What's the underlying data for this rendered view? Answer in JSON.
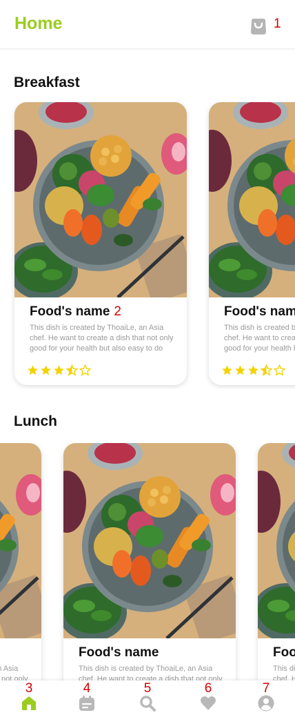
{
  "header": {
    "title": "Home",
    "cart_count": "1"
  },
  "sections": {
    "breakfast": {
      "title": "Breakfast",
      "cards": [
        {
          "name": "Food's name",
          "name_badge": "2",
          "description": "This dish is created by ThoaiLe, an Asia chef. He want to create a dish that not only good for your health but also easy to do",
          "rating": 3.5
        },
        {
          "name": "Food's name",
          "name_badge": "",
          "description": "This dish is created by ThoaiLe, an Asia chef. He want to create a dish that not only good for your health but also easy to do",
          "rating": 3.5
        }
      ]
    },
    "lunch": {
      "title": "Lunch",
      "cards": [
        {
          "name": "",
          "description": "This dish is created by ThoaiLe, an Asia chef. He want to create a dish that not only good for your health but also easy to do"
        },
        {
          "name": "Food's name",
          "description": "This dish is created by ThoaiLe, an Asia chef. He want to create a dish that not only good for your health but also easy to do"
        },
        {
          "name": "Food's name",
          "description": "This dish is created by ThoaiLe, an Asia chef. He want to create a dish that not only good for your health but also easy to do"
        }
      ]
    }
  },
  "bottom_nav": [
    {
      "number": "3",
      "icon": "home-icon",
      "active": true
    },
    {
      "number": "4",
      "icon": "calendar-icon",
      "active": false
    },
    {
      "number": "5",
      "icon": "search-icon",
      "active": false
    },
    {
      "number": "6",
      "icon": "heart-icon",
      "active": false
    },
    {
      "number": "7",
      "icon": "profile-icon",
      "active": false
    }
  ],
  "colors": {
    "accent": "#9ACD1F",
    "star": "#F2D300",
    "icon_inactive": "#B8B8B8",
    "label_red": "#D40000"
  }
}
